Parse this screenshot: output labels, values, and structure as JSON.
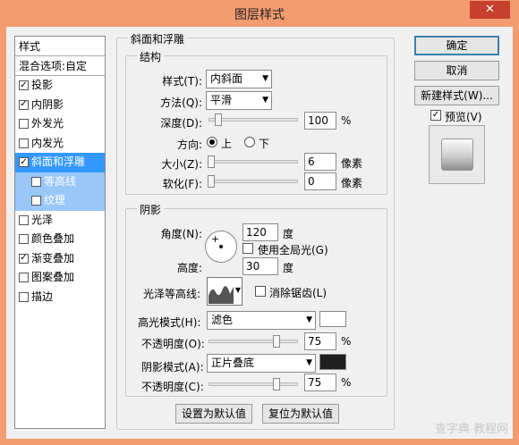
{
  "window": {
    "title": "图层样式",
    "close_label": "✕"
  },
  "style_list": {
    "header": "样式",
    "blend_options": "混合选项:自定",
    "items": [
      {
        "label": "投影",
        "checked": true
      },
      {
        "label": "内阴影",
        "checked": true
      },
      {
        "label": "外发光",
        "checked": false
      },
      {
        "label": "内发光",
        "checked": false
      },
      {
        "label": "斜面和浮雕",
        "checked": true,
        "selected": true
      },
      {
        "label": "等高线",
        "checked": false,
        "sub": true
      },
      {
        "label": "纹理",
        "checked": false,
        "sub": true
      },
      {
        "label": "光泽",
        "checked": false
      },
      {
        "label": "颜色叠加",
        "checked": false
      },
      {
        "label": "渐变叠加",
        "checked": true
      },
      {
        "label": "图案叠加",
        "checked": false
      },
      {
        "label": "描边",
        "checked": false
      }
    ]
  },
  "bevel": {
    "group_title": "斜面和浮雕",
    "structure": {
      "title": "结构",
      "style_label": "样式(T):",
      "style_value": "内斜面",
      "method_label": "方法(Q):",
      "method_value": "平滑",
      "depth_label": "深度(D):",
      "depth_value": "100",
      "depth_unit": "%",
      "depth_level": 0.1,
      "direction_label": "方向:",
      "dir_up": "上",
      "dir_down": "下",
      "size_label": "大小(Z):",
      "size_value": "6",
      "size_unit": "像素",
      "soften_label": "软化(F):",
      "soften_value": "0",
      "soften_unit": "像素"
    },
    "shading": {
      "title": "阴影",
      "angle_label": "角度(N):",
      "angle_value": "120",
      "angle_unit": "度",
      "global_light": "使用全局光(G)",
      "altitude_label": "高度:",
      "altitude_value": "30",
      "altitude_unit": "度",
      "gloss_label": "光泽等高线:",
      "anti_alias": "消除锯齿(L)",
      "highlight_label": "高光模式(H):",
      "highlight_mode": "滤色",
      "highlight_color": "#ffffff",
      "opacity1_label": "不透明度(O):",
      "opacity1_value": "75",
      "opacity_unit": "%",
      "shadow_label": "阴影模式(A):",
      "shadow_mode": "正片叠底",
      "shadow_color": "#1e1e1e",
      "opacity2_label": "不透明度(C):",
      "opacity2_value": "75"
    },
    "make_default": "设置为默认值",
    "reset_default": "复位为默认值"
  },
  "buttons": {
    "ok": "确定",
    "cancel": "取消",
    "new_style": "新建样式(W)...",
    "preview": "预览(V)"
  },
  "watermark": "查字典 教程网",
  "colors": {
    "title_bar": "#f39c70",
    "selection": "#3399ff",
    "sub_item": "#99c7f7"
  }
}
